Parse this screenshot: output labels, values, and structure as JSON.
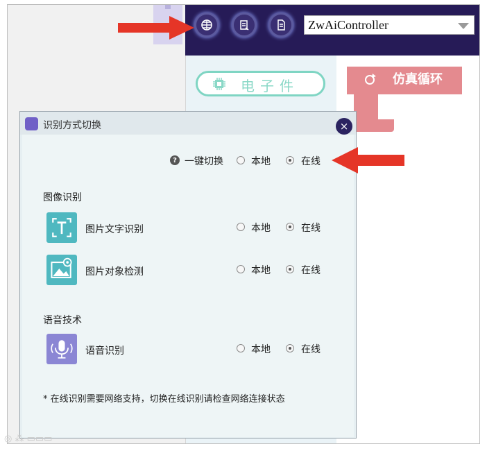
{
  "toolbar": {
    "controller_select": "ZwAiController",
    "icons": [
      "ai-mode-icon",
      "training-icon",
      "upload-icon"
    ]
  },
  "palette": {
    "chip_label": "电子件",
    "block_label": "仿真循环"
  },
  "dialog": {
    "title": "识别方式切换",
    "close": "×",
    "one_key": {
      "label": "一键切换",
      "local": "本地",
      "online": "在线",
      "selected": "online"
    },
    "sections": [
      {
        "title": "图像识别",
        "items": [
          {
            "label": "图片文字识别",
            "local": "本地",
            "online": "在线",
            "selected": "online",
            "icon": "text-recognition-icon"
          },
          {
            "label": "图片对象检测",
            "local": "本地",
            "online": "在线",
            "selected": "online",
            "icon": "image-detection-icon"
          }
        ]
      },
      {
        "title": "语音技术",
        "items": [
          {
            "label": "语音识别",
            "local": "本地",
            "online": "在线",
            "selected": "online",
            "icon": "voice-recognition-icon"
          }
        ]
      }
    ],
    "note": "* 在线识别需要网络支持，切换在线识别请检查网络连接状态"
  },
  "colors": {
    "topbar": "#261b57",
    "accent_arrow": "#e53527",
    "feature_teal": "#4fb8c0",
    "feature_purple": "#8b86d4",
    "chip_border": "#7fd5c3",
    "block": "#e48a8f"
  }
}
